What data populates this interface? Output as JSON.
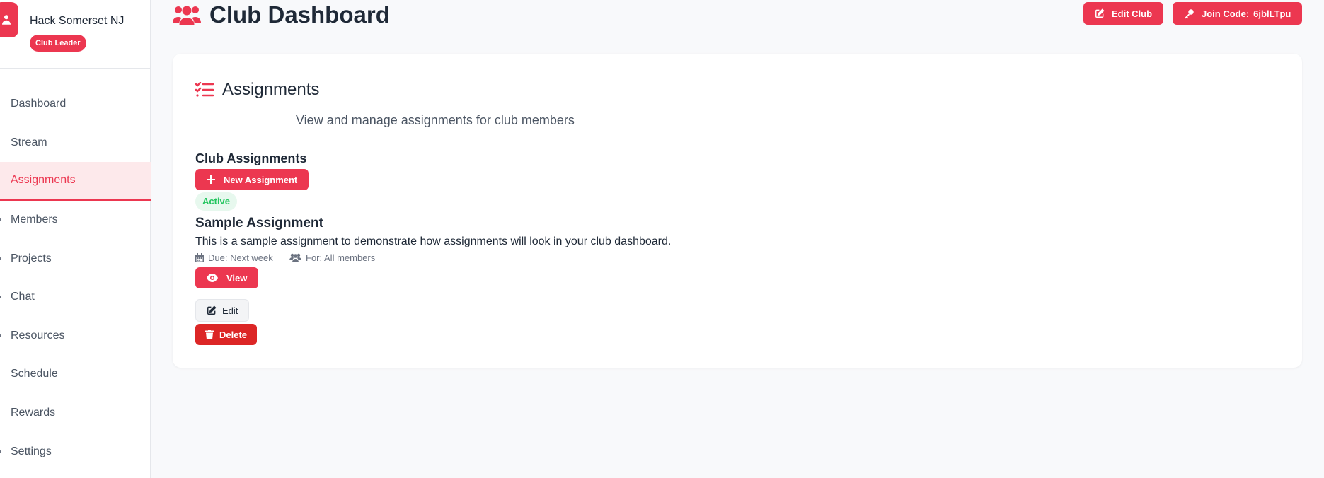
{
  "sidebar": {
    "club_name": "Hack Somerset NJ",
    "role_badge": "Club Leader",
    "items": [
      {
        "label": "Dashboard",
        "dot": false
      },
      {
        "label": "Stream",
        "dot": false
      },
      {
        "label": "Assignments",
        "dot": false
      },
      {
        "label": "Members",
        "dot": true
      },
      {
        "label": "Projects",
        "dot": true
      },
      {
        "label": "Chat",
        "dot": true
      },
      {
        "label": "Resources",
        "dot": true
      },
      {
        "label": "Schedule",
        "dot": false
      },
      {
        "label": "Rewards",
        "dot": false
      },
      {
        "label": "Settings",
        "dot": true
      }
    ],
    "active_index": 2
  },
  "header": {
    "title": "Club Dashboard",
    "edit_club_label": "Edit Club",
    "join_code_label": "Join Code:",
    "join_code_value": "6jblLTpu"
  },
  "assignments": {
    "title": "Assignments",
    "description": "View and manage assignments for club members",
    "subheading": "Club Assignments",
    "new_button": "New Assignment",
    "item": {
      "status": "Active",
      "title": "Sample Assignment",
      "description": "This is a sample assignment to demonstrate how assignments will look in your club dashboard.",
      "due": "Due: Next week",
      "for": "For: All members",
      "view_label": "View",
      "edit_label": "Edit",
      "delete_label": "Delete"
    }
  },
  "colors": {
    "accent": "#ec3750",
    "danger": "#dc2626",
    "success": "#22c55e"
  }
}
